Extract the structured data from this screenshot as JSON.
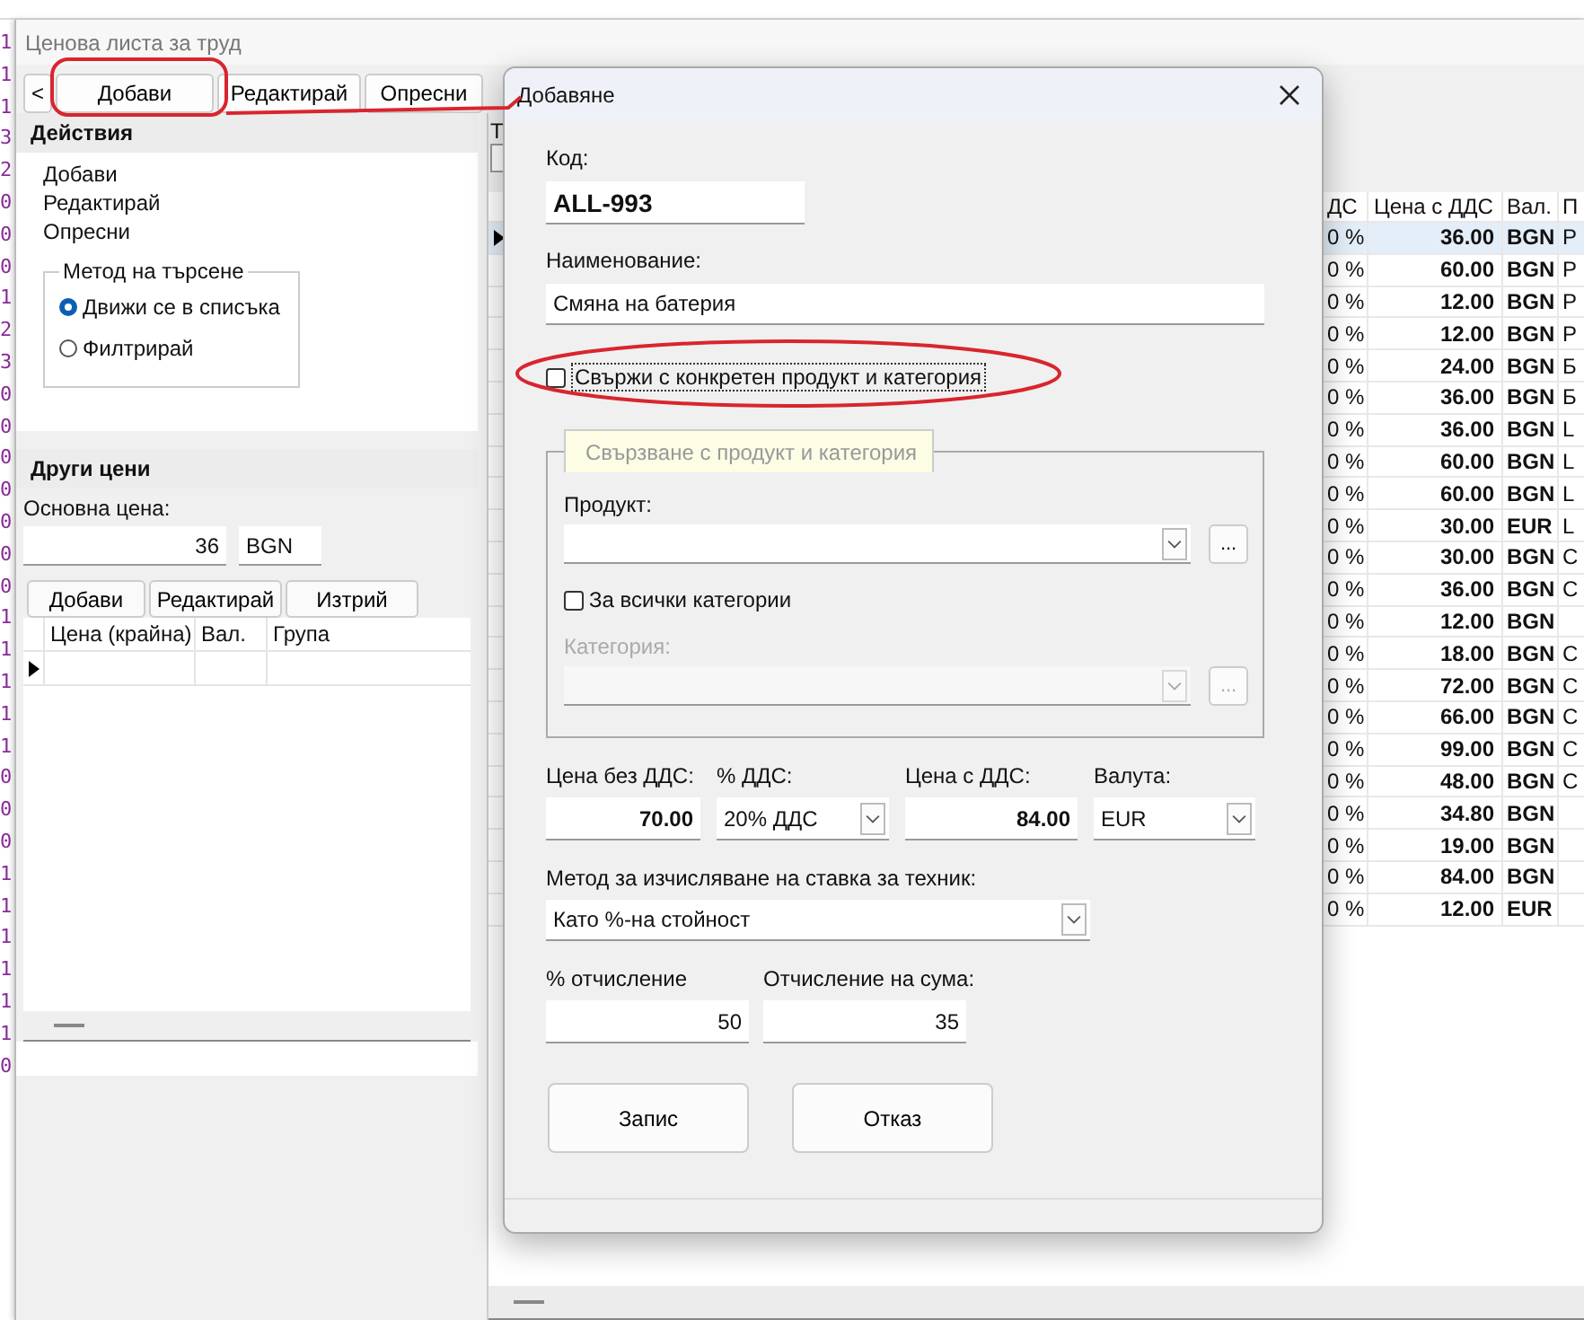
{
  "background_digits": [
    "1",
    "1",
    "1",
    "3",
    "2",
    "0",
    "0",
    "0",
    "1",
    "2",
    "3",
    "0",
    "0",
    "0",
    "0",
    "0",
    "0",
    "0",
    "1",
    "1",
    "1",
    "1",
    "1",
    "0",
    "0",
    "0",
    "1",
    "1",
    "1",
    "1",
    "1",
    "1",
    "0"
  ],
  "window": {
    "title": "Ценова листа за труд"
  },
  "toolbar": [
    {
      "label": "<"
    },
    {
      "label": "Добави"
    },
    {
      "label": "Редактирай"
    },
    {
      "label": "Опресни"
    }
  ],
  "actions_panel": {
    "title": "Действия",
    "links": [
      "Добави",
      "Редактирай",
      "Опресни"
    ],
    "search_method": {
      "title": "Метод на търсене",
      "options": [
        {
          "label": "Движи се в списъка",
          "selected": true
        },
        {
          "label": "Филтрирай",
          "selected": false
        }
      ]
    }
  },
  "other_prices": {
    "title": "Други цени",
    "base_price_label": "Основна цена:",
    "base_price": "36",
    "currency": "BGN",
    "buttons": [
      "Добави",
      "Редактирай",
      "Изтрий"
    ],
    "columns": [
      "Цена (крайна)",
      "Вал.",
      "Група"
    ]
  },
  "price_table": {
    "header_fragment": "Т",
    "columns": [
      "ДС",
      "Цена с ДДС",
      "Вал.",
      "П"
    ],
    "rows": [
      {
        "vat": "0 %",
        "price": "36.00",
        "currency": "BGN",
        "product": "P",
        "selected": true
      },
      {
        "vat": "0 %",
        "price": "60.00",
        "currency": "BGN",
        "product": "P",
        "selected": false
      },
      {
        "vat": "0 %",
        "price": "12.00",
        "currency": "BGN",
        "product": "P",
        "selected": false
      },
      {
        "vat": "0 %",
        "price": "12.00",
        "currency": "BGN",
        "product": "P",
        "selected": false
      },
      {
        "vat": "0 %",
        "price": "24.00",
        "currency": "BGN",
        "product": "Б",
        "selected": false
      },
      {
        "vat": "0 %",
        "price": "36.00",
        "currency": "BGN",
        "product": "Б",
        "selected": false
      },
      {
        "vat": "0 %",
        "price": "36.00",
        "currency": "BGN",
        "product": "L",
        "selected": false
      },
      {
        "vat": "0 %",
        "price": "60.00",
        "currency": "BGN",
        "product": "L",
        "selected": false
      },
      {
        "vat": "0 %",
        "price": "60.00",
        "currency": "BGN",
        "product": "L",
        "selected": false
      },
      {
        "vat": "0 %",
        "price": "30.00",
        "currency": "EUR",
        "product": "L",
        "selected": false
      },
      {
        "vat": "0 %",
        "price": "30.00",
        "currency": "BGN",
        "product": "C",
        "selected": false
      },
      {
        "vat": "0 %",
        "price": "36.00",
        "currency": "BGN",
        "product": "C",
        "selected": false
      },
      {
        "vat": "0 %",
        "price": "12.00",
        "currency": "BGN",
        "selected": false
      },
      {
        "vat": "0 %",
        "price": "18.00",
        "currency": "BGN",
        "product": "C",
        "selected": false
      },
      {
        "vat": "0 %",
        "price": "72.00",
        "currency": "BGN",
        "product": "C",
        "selected": false
      },
      {
        "vat": "0 %",
        "price": "66.00",
        "currency": "BGN",
        "product": "C",
        "selected": false
      },
      {
        "vat": "0 %",
        "price": "99.00",
        "currency": "BGN",
        "product": "C",
        "selected": false
      },
      {
        "vat": "0 %",
        "price": "48.00",
        "currency": "BGN",
        "product": "C",
        "selected": false
      },
      {
        "vat": "0 %",
        "price": "34.80",
        "currency": "BGN",
        "selected": false
      },
      {
        "vat": "0 %",
        "price": "19.00",
        "currency": "BGN",
        "selected": false
      },
      {
        "vat": "0 %",
        "price": "84.00",
        "currency": "BGN",
        "selected": false
      },
      {
        "vat": "0 %",
        "price": "12.00",
        "currency": "EUR",
        "selected": false
      }
    ]
  },
  "dialog": {
    "title": "Добавяне",
    "code_label": "Код:",
    "code": "ALL-993",
    "name_label": "Наименование:",
    "name": "Смяна на батерия",
    "link_checkbox": {
      "label": "Свържи с конкретен продукт и категория",
      "checked": false,
      "focused": true
    },
    "link_group": {
      "title": "Свързване с продукт и категория",
      "product_label": "Продукт:",
      "browse": "...",
      "all_categories": {
        "label": "За всички категории",
        "checked": false
      },
      "category_label": "Категория:",
      "category_disabled": true,
      "category_browse": "..."
    },
    "price_without_vat_label": "Цена без ДДС:",
    "price_without_vat": "70.00",
    "vat_label": "% ДДС:",
    "vat": "20% ДДС",
    "price_with_vat_label": "Цена с ДДС:",
    "price_with_vat": "84.00",
    "currency_label": "Валута:",
    "currency": "EUR",
    "method_label": "Метод за изчисляване на ставка за техник:",
    "method": "Като %-на стойност",
    "percent_label": "% отчисление",
    "percent": "50",
    "amount_label": "Отчисление на сума:",
    "amount": "35",
    "buttons": [
      "Запис",
      "Отказ"
    ]
  }
}
